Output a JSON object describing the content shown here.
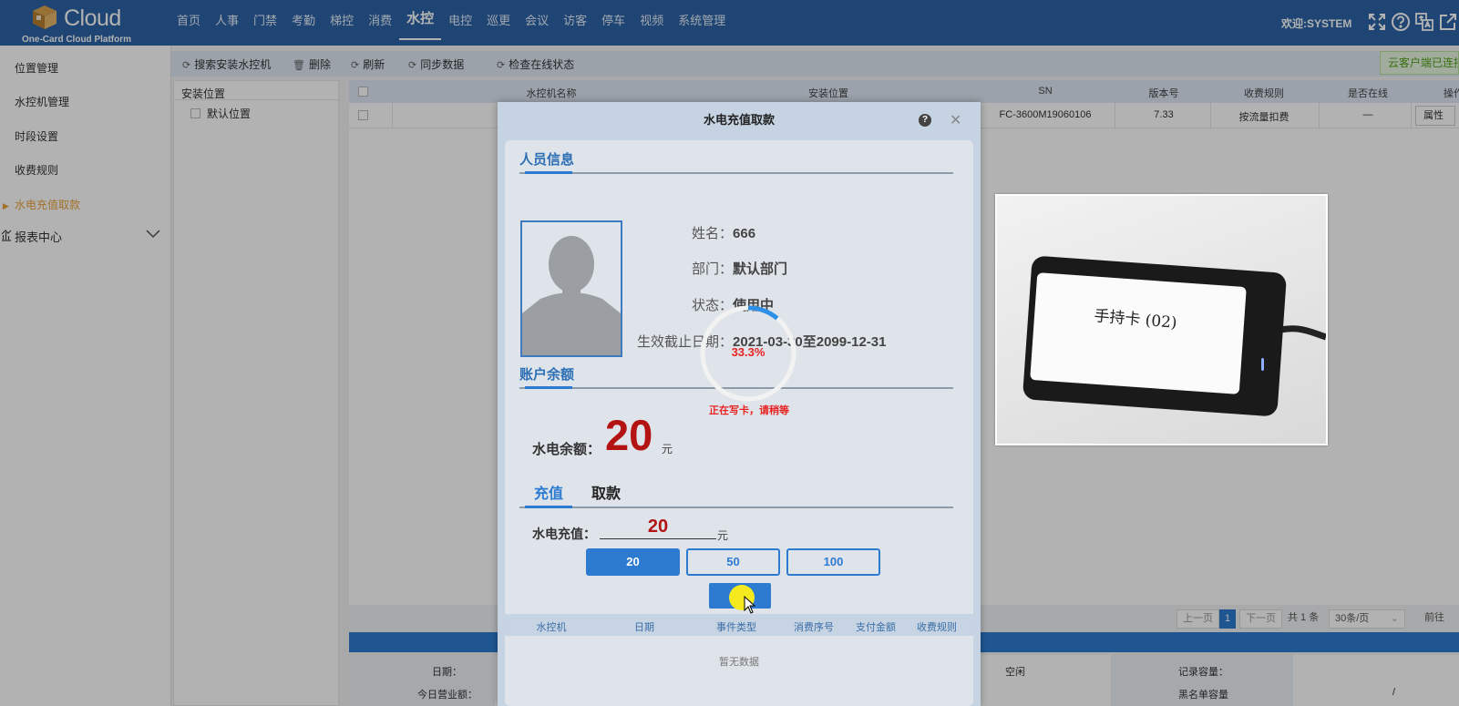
{
  "header": {
    "logo_text": "Cloud",
    "logo_sub": "One-Card Cloud Platform",
    "nav": [
      "首页",
      "人事",
      "门禁",
      "考勤",
      "梯控",
      "消费",
      "水控",
      "电控",
      "巡更",
      "会议",
      "访客",
      "停车",
      "视频",
      "系统管理"
    ],
    "active_nav": "水控",
    "welcome": "欢迎:SYSTEM",
    "icons": [
      "fullscreen-icon",
      "help-icon",
      "language-icon",
      "external-link-icon"
    ]
  },
  "sidebar": {
    "items": [
      "位置管理",
      "水控机管理",
      "时段设置",
      "收费规则",
      "水电充值取款"
    ],
    "active_item": "水电充值取款",
    "report_center": "报表中心"
  },
  "toolbar": {
    "search_install": "搜索安装水控机",
    "delete": "删除",
    "refresh": "刷新",
    "sync": "同步数据",
    "check_online": "检查在线状态",
    "cloud_status": "云客户端已连接"
  },
  "tree": {
    "header": "安装位置",
    "nodes": [
      "默认位置"
    ]
  },
  "table": {
    "columns": [
      "水控机名称",
      "安装位置",
      "SN",
      "版本号",
      "收费规则",
      "是否在线",
      "操作"
    ],
    "rows": [
      {
        "sn": "FC-3600M19060106",
        "version": "7.33",
        "rule": "按流量扣费",
        "online": "—",
        "op": "属性"
      }
    ]
  },
  "pager": {
    "prev": "上一页",
    "current": "1",
    "next": "下一页",
    "total": "共 1 条",
    "page_size": "30条/页",
    "goto": "前往"
  },
  "bottom": {
    "date_label": "日期：",
    "today_label": "今日营业额：",
    "status": "空闲",
    "record_capacity": "记录容量：",
    "blacklist_capacity": "黑名单容量",
    "blacklist_value": "/"
  },
  "modal": {
    "title": "水电充值取款",
    "person_section": "人员信息",
    "name_label": "姓名：",
    "name": "666",
    "dept_label": "部门：",
    "dept": "默认部门",
    "status_label": "状态：",
    "status": "使用中",
    "valid_label": "生效截止日期：",
    "valid": "2021-03-30至2099-12-31",
    "account_section": "账户余额",
    "balance_label": "水电余额：",
    "balance": "20",
    "unit": "元",
    "tab_charge": "充值",
    "tab_withdraw": "取款",
    "charge_label": "水电充值：",
    "charge_value": "20",
    "amounts": [
      "20",
      "50",
      "100"
    ],
    "selected_amount": "20",
    "submit": "充值",
    "record_columns": [
      "水控机",
      "日期",
      "事件类型",
      "消费序号",
      "支付金额",
      "收费规则"
    ],
    "no_data": "暂无数据"
  },
  "progress": {
    "percent": "33.3%",
    "fraction": 0.333,
    "message": "正在写卡，请稍等"
  },
  "photo": {
    "label": "手持卡 (02)"
  },
  "colors": {
    "header_bg": "#2d63a6",
    "accent": "#2d7bd0",
    "balance_red": "#b31313",
    "active_side": "#e9a23b"
  }
}
